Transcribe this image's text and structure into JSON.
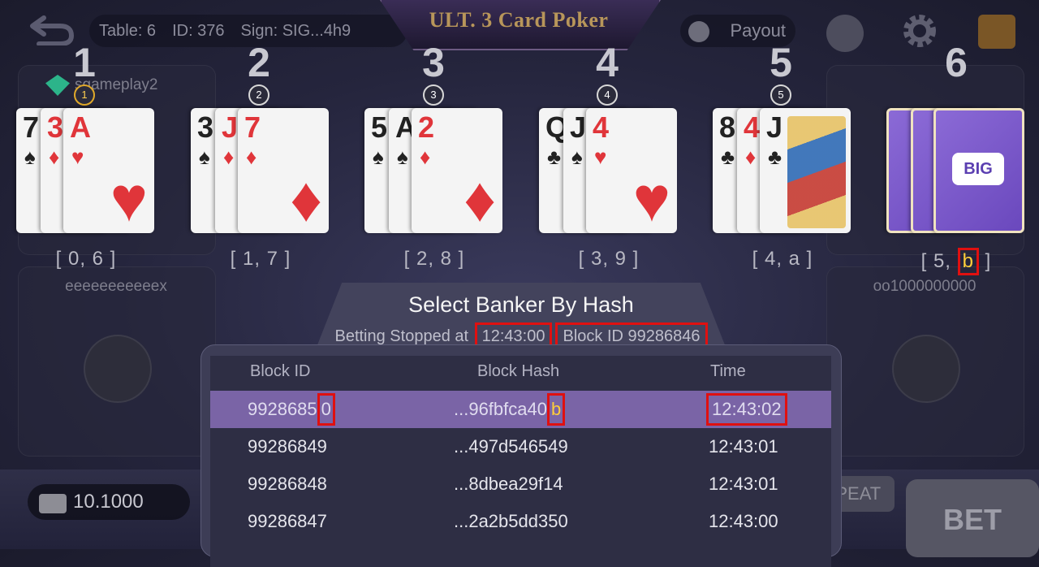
{
  "header": {
    "title": "ULT. 3 Card Poker",
    "table_label": "Table: 6",
    "id_label": "ID: 376",
    "sign_label": "Sign: SIG...4h9",
    "payout_label": "Payout"
  },
  "seats": [
    {
      "number": "1",
      "badge": "1",
      "pair": "[ 0, 6 ]",
      "cards": [
        {
          "rank": "7",
          "suit": "♠",
          "color": "blk"
        },
        {
          "rank": "3",
          "suit": "♦",
          "color": "red"
        },
        {
          "rank": "A",
          "suit": "♥",
          "color": "red"
        }
      ]
    },
    {
      "number": "2",
      "badge": "2",
      "pair": "[ 1, 7 ]",
      "cards": [
        {
          "rank": "3",
          "suit": "♠",
          "color": "blk"
        },
        {
          "rank": "J",
          "suit": "♦",
          "color": "red"
        },
        {
          "rank": "7",
          "suit": "♦",
          "color": "red"
        }
      ]
    },
    {
      "number": "3",
      "badge": "3",
      "pair": "[ 2, 8 ]",
      "cards": [
        {
          "rank": "5",
          "suit": "♠",
          "color": "blk"
        },
        {
          "rank": "A",
          "suit": "♠",
          "color": "blk"
        },
        {
          "rank": "2",
          "suit": "♦",
          "color": "red"
        }
      ]
    },
    {
      "number": "4",
      "badge": "4",
      "pair": "[ 3, 9 ]",
      "cards": [
        {
          "rank": "Q",
          "suit": "♣",
          "color": "blk"
        },
        {
          "rank": "J",
          "suit": "♠",
          "color": "blk"
        },
        {
          "rank": "4",
          "suit": "♥",
          "color": "red"
        }
      ]
    },
    {
      "number": "5",
      "badge": "5",
      "pair": "[ 4, a ]",
      "cards": [
        {
          "rank": "8",
          "suit": "♣",
          "color": "blk"
        },
        {
          "rank": "4",
          "suit": "♦",
          "color": "red"
        },
        {
          "rank": "J",
          "suit": "♣",
          "color": "blk"
        }
      ]
    },
    {
      "number": "6",
      "badge": "",
      "pair_prefix": "[ 5, ",
      "pair_highlight": "b",
      "pair_suffix": " ]",
      "card_back_logo": "BIG"
    }
  ],
  "players": {
    "top_left_name": "sgameplay2",
    "left_name": "eeeeeeeeeeex",
    "right_name": "oo1000000000"
  },
  "modal": {
    "title": "Select Banker By Hash",
    "betting_stopped_prefix": "Betting Stopped at ",
    "betting_stopped_time": "12:43:00",
    "block_id_label": "Block ID 99286846",
    "columns": [
      "Block ID",
      "Block Hash",
      "Time"
    ],
    "rows": [
      {
        "block_id_main": "9928685",
        "block_id_last": "0",
        "hash_main": "...96fbfca40",
        "hash_last": "b",
        "time": "12:43:02"
      },
      {
        "block_id": "99286849",
        "hash": "...497d546549",
        "time": "12:43:01"
      },
      {
        "block_id": "99286848",
        "hash": "...8dbea29f14",
        "time": "12:43:01"
      },
      {
        "block_id": "99286847",
        "hash": "...2a2b5dd350",
        "time": "12:43:00"
      }
    ]
  },
  "bottom": {
    "balance": "10.1000",
    "repeat_label": "REPEAT",
    "bet_label": "BET"
  }
}
